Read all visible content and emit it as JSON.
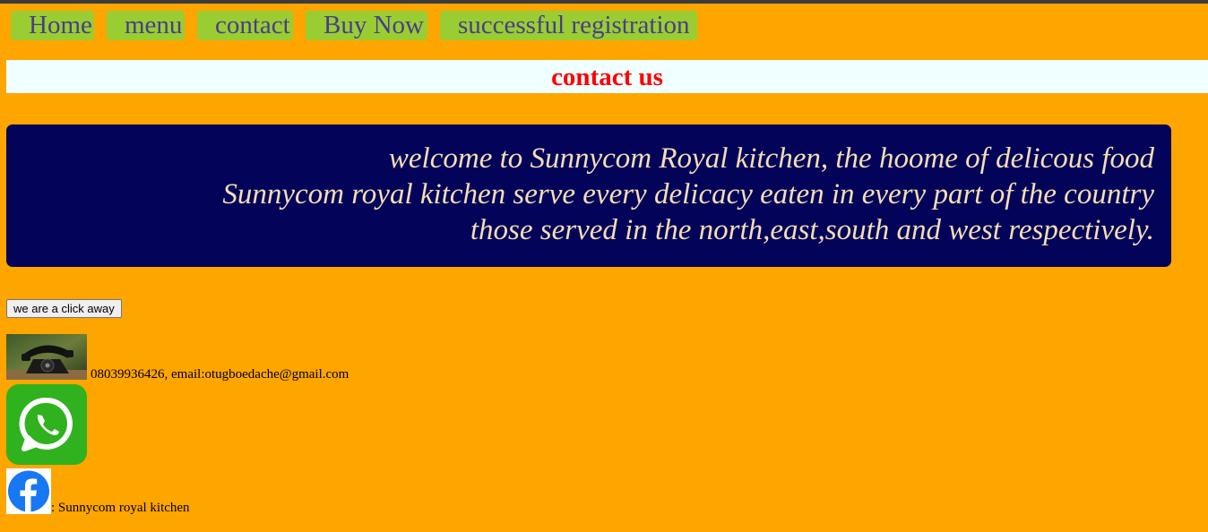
{
  "nav": {
    "items": [
      {
        "label": "Home"
      },
      {
        "label": "menu"
      },
      {
        "label": "contact"
      },
      {
        "label": "Buy Now"
      },
      {
        "label": "successful registration"
      }
    ]
  },
  "heading": "contact us",
  "welcome": {
    "lines": [
      "welcome to Sunnycom Royal kitchen, the hoome of delicous food",
      "Sunnycom royal kitchen serve every delicacy eaten in every part of the country",
      "those served in the north,east,south and west respectively."
    ]
  },
  "click_button": "we are a click away",
  "contact": {
    "phone_icon": "telephone-icon",
    "text": "08039936426, email:otugboedache@gmail.com"
  },
  "whatsapp": {
    "icon": "whatsapp-icon"
  },
  "facebook": {
    "icon": "facebook-icon",
    "text": ": Sunnycom royal kitchen"
  },
  "colors": {
    "page_background": "#ffa500",
    "nav_background": "#9acd32",
    "nav_text": "#483d8b",
    "heading_bar": "#f0ffff",
    "heading_text": "#ff0000",
    "welcome_background": "#04035a",
    "welcome_text": "#f5deb3",
    "whatsapp_green": "#2fb21e",
    "facebook_blue": "#1877f2"
  }
}
